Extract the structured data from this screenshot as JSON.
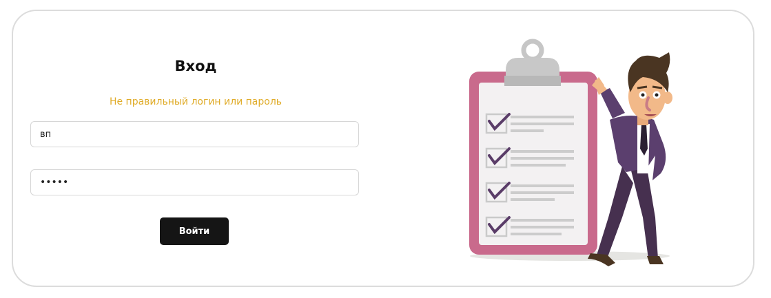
{
  "form": {
    "title": "Вход",
    "error_message": "Не правильный логин или пароль",
    "login_value": "вп",
    "password_value": "•••••",
    "submit_label": "Войти"
  },
  "illustration": {
    "subject": "businessman-with-checklist-clipboard",
    "colors": {
      "clipboard_frame": "#c96a8c",
      "clipboard_paper": "#f3f1f2",
      "clip": "#bfbfbf",
      "suit": "#5b3f6e",
      "pants": "#46304f",
      "skin": "#f2b989",
      "hair": "#4a3522",
      "checkmark": "#5a3c68"
    },
    "checklist_items": 4
  }
}
